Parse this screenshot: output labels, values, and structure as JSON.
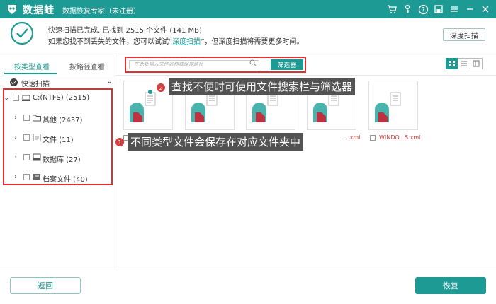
{
  "app": {
    "name": "数据蛙",
    "subtitle": "数据恢复专家（未注册）",
    "brand_color": "#1e9a94"
  },
  "status": {
    "line1": "快速扫描已完成, 已找到 2515 个文件 (141 MB)",
    "line2_prefix": "如果您找不到丢失的文件，您可以试试“",
    "deep_link": "深度扫描",
    "line2_suffix": "”，但深度扫描将需要更多时间。",
    "deep_button": "深度扫描"
  },
  "left_panel": {
    "tab_type": "按类型查看",
    "tab_path": "按路径查看",
    "quick_scan": "快速扫描",
    "root": "C:(NTFS) (2515)",
    "items": [
      {
        "label": "其他 (2437)",
        "icon": "folder-icon"
      },
      {
        "label": "文件 (11)",
        "icon": "document-icon"
      },
      {
        "label": "数据库 (27)",
        "icon": "database-icon"
      },
      {
        "label": "档案文件 (40)",
        "icon": "archive-icon"
      }
    ]
  },
  "toolbar": {
    "search_placeholder": "在此处输入文件名称或保存路径",
    "filter_button": "筛选器"
  },
  "files": [
    {
      "label": ""
    },
    {
      "label": ""
    },
    {
      "label": ""
    },
    {
      "label": "...xml"
    },
    {
      "label": "WINDO...S.xml"
    }
  ],
  "callouts": {
    "badge1": "1",
    "text1": "不同类型文件会保存在对应文件夹中",
    "badge2": "2",
    "text2": "查找不便时可使用文件搜索栏与筛选器"
  },
  "footer": {
    "back": "返回",
    "recover": "恢复"
  }
}
